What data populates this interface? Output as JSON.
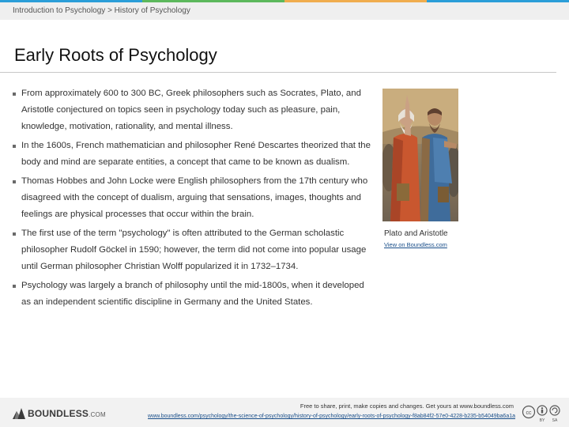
{
  "accent_colors": [
    "#2b9ed8",
    "#5cb85c",
    "#f0ad4e",
    "#2b9ed8"
  ],
  "breadcrumb": "Introduction to Psychology > History of Psychology",
  "title": "Early Roots of Psychology",
  "bullets": [
    "From approximately 600 to 300 BC, Greek philosophers such as Socrates, Plato, and Aristotle conjectured on topics seen in psychology today such as pleasure, pain, knowledge, motivation, rationality, and mental illness.",
    "In the 1600s, French mathematician and philosopher René Descartes theorized that the body and mind are separate entities, a concept that came to be known as dualism.",
    "Thomas Hobbes and John Locke were English philosophers from the 17th century who disagreed with the concept of dualism, arguing that sensations, images, thoughts and feelings are physical processes that occur within the brain.",
    "The first use of the term \"psychology\" is often attributed to the German scholastic philosopher Rudolf Göckel in 1590; however, the term did not come into popular usage until German philosopher Christian Wolff popularized it in 1732–1734.",
    "Psychology was largely a branch of philosophy until the mid-1800s, when it developed as an independent scientific discipline in Germany and the United States."
  ],
  "image": {
    "caption": "Plato and Aristotle",
    "link_text": "View on Boundless.com"
  },
  "footer": {
    "logo_main": "BOUNDLESS",
    "logo_suffix": ".COM",
    "share_text": "Free to share, print, make copies and changes. Get yours at www.boundless.com",
    "url": "www.boundless.com/psychology/the-science-of-psychology/history-of-psychology/early-roots-of-psychology-f8ab84f2-57e0-4228-b235-b54049ba6a1a",
    "cc_labels": [
      "BY",
      "SA"
    ]
  }
}
